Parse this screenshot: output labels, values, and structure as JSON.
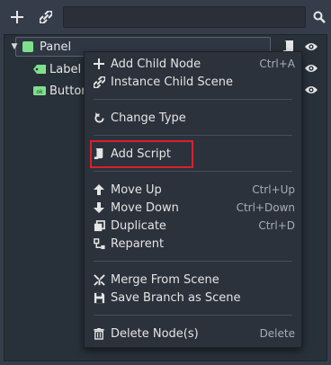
{
  "toolbar": {
    "add_icon": "plus-icon",
    "link_icon": "link-icon",
    "filter_value": "",
    "search_icon": "search-icon"
  },
  "tree": {
    "nodes": [
      {
        "label": "Panel",
        "icon": "panel-node-icon",
        "color": "#7fe08c"
      },
      {
        "label": "Label",
        "icon": "label-node-icon",
        "color": "#7fe08c"
      },
      {
        "label": "Button",
        "icon": "button-node-icon",
        "color": "#7fe08c"
      }
    ]
  },
  "menu": {
    "items": [
      {
        "label": "Add Child Node",
        "shortcut": "Ctrl+A",
        "icon": "plus-icon"
      },
      {
        "label": "Instance Child Scene",
        "shortcut": "",
        "icon": "link-icon"
      },
      {
        "label": "Change Type",
        "shortcut": "",
        "icon": "rotate-icon"
      },
      {
        "label": "Add Script",
        "shortcut": "",
        "icon": "script-icon"
      },
      {
        "label": "Move Up",
        "shortcut": "Ctrl+Up",
        "icon": "arrow-up-icon"
      },
      {
        "label": "Move Down",
        "shortcut": "Ctrl+Down",
        "icon": "arrow-down-icon"
      },
      {
        "label": "Duplicate",
        "shortcut": "Ctrl+D",
        "icon": "duplicate-icon"
      },
      {
        "label": "Reparent",
        "shortcut": "",
        "icon": "reparent-icon"
      },
      {
        "label": "Merge From Scene",
        "shortcut": "",
        "icon": "merge-icon"
      },
      {
        "label": "Save Branch as Scene",
        "shortcut": "",
        "icon": "save-icon"
      },
      {
        "label": "Delete Node(s)",
        "shortcut": "Delete",
        "icon": "trash-icon"
      }
    ]
  },
  "highlight_color": "#d9212b"
}
